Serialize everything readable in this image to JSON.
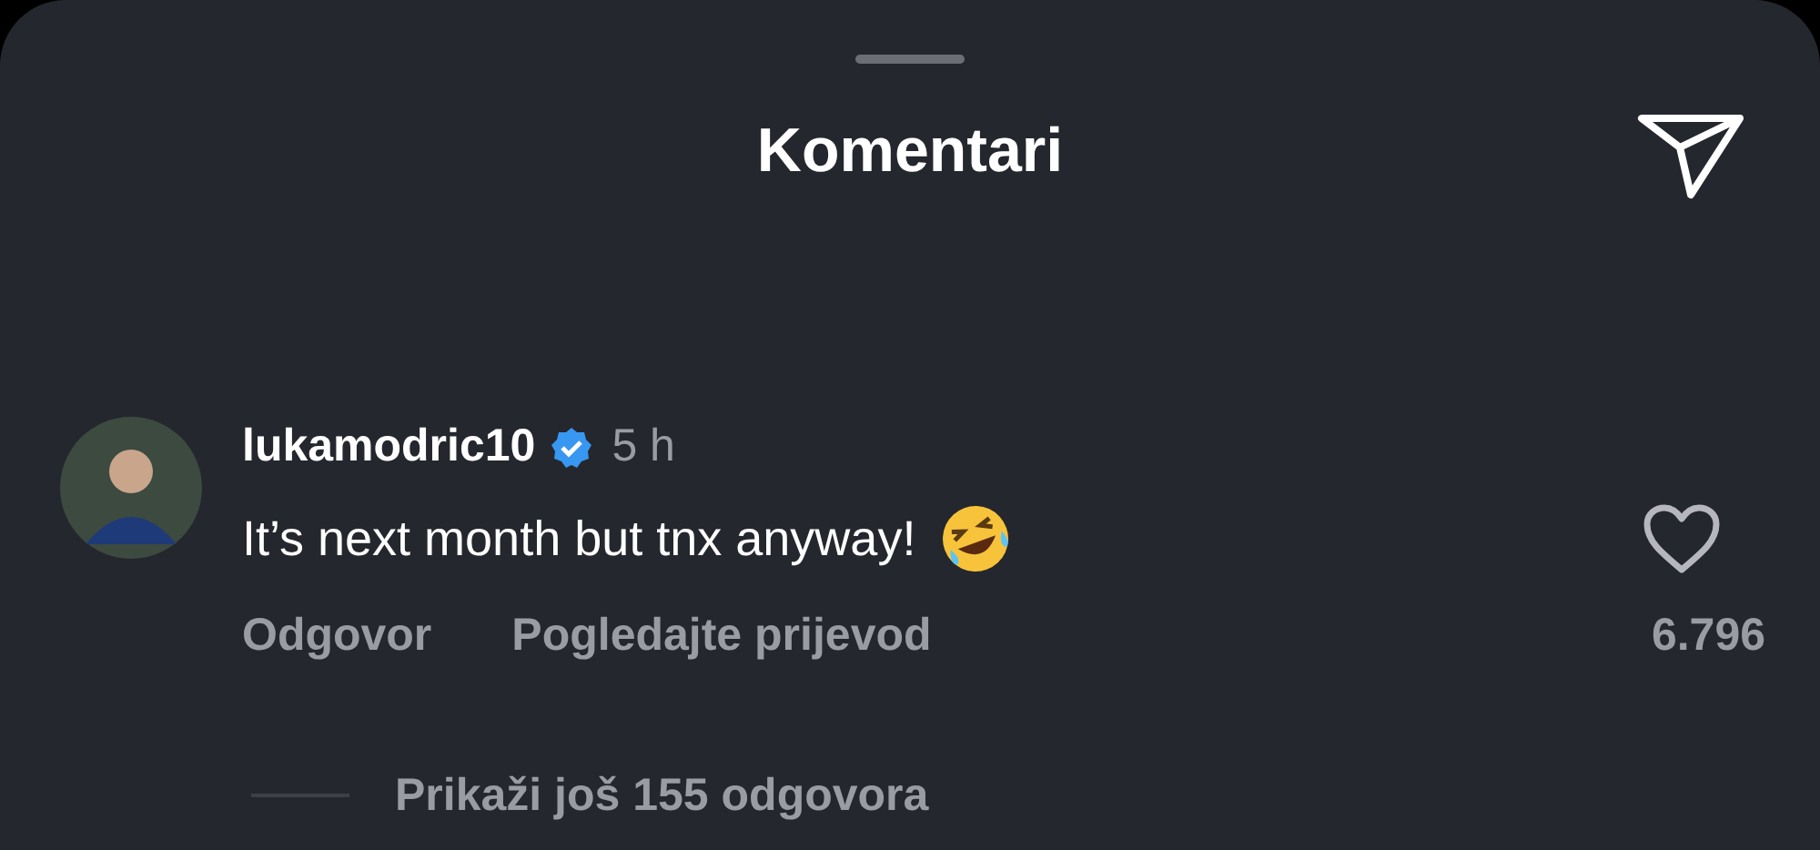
{
  "sheet": {
    "title": "Komentari"
  },
  "comment": {
    "username": "lukamodric10",
    "verified": true,
    "time": "5 h",
    "text": "It’s next month but tnx anyway!",
    "actions": [
      "Odgovor",
      "Pogledajte prijevod"
    ],
    "likes": "6.796",
    "liked": false
  },
  "replies_link": "Prikaži još 155 odgovora"
}
